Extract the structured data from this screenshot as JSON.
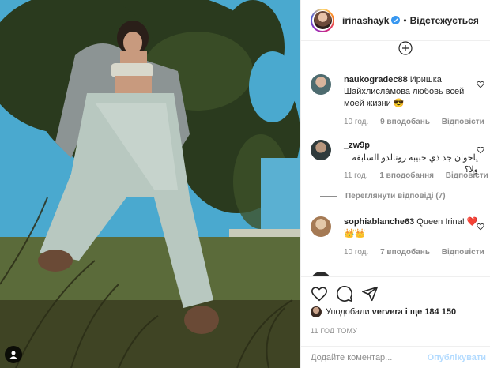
{
  "header": {
    "username": "irinashayk",
    "follow_label": "Відстежується"
  },
  "comments": [
    {
      "username": "naukogradec88",
      "text": "Иришка Шайхлисла́мова любовь всей моей жизни 😎",
      "time": "10 год.",
      "likes": "9 вподобань",
      "reply_label": "Відповісти"
    },
    {
      "username": "_zw9p",
      "text": "ياحوان جد ذي حبيبة رونالدو السابقة ولا؟",
      "time": "11 год.",
      "likes": "1 вподобання",
      "reply_label": "Відповісти",
      "view_replies": "Переглянути відповіді (7)"
    },
    {
      "username": "sophiablanche63",
      "text": "Queen Irina! ❤️ 👑👑",
      "time": "10 год.",
      "likes": "7 вподобань",
      "reply_label": "Відповісти"
    }
  ],
  "likes": {
    "prefix": "Уподобали",
    "user": "ververa",
    "suffix": "і ще 184 150"
  },
  "timestamp": "11 ГОД ТОМУ",
  "add_comment": {
    "placeholder": "Додайте коментар...",
    "publish_label": "Опублікувати"
  },
  "colors": {
    "verified": "#3897f0",
    "heart": "#ed4956",
    "publish_disabled": "#b3dbff"
  }
}
